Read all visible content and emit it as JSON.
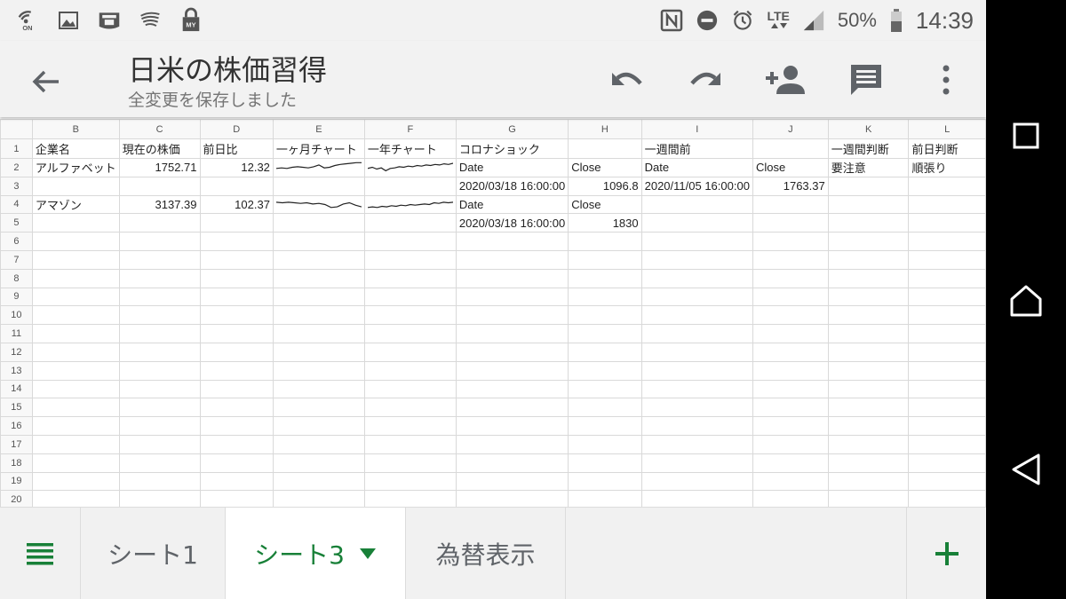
{
  "status_bar": {
    "battery": "50%",
    "time": "14:39",
    "network": "LTE",
    "left_icons": [
      "wifi-on-icon",
      "image-icon",
      "lawson-app-icon",
      "wing-app-icon",
      "lock-bag-icon"
    ],
    "right_icons": [
      "nfc-icon",
      "dnd-icon",
      "alarm-icon",
      "lte-icon",
      "signal-icon",
      "battery-icon"
    ]
  },
  "app_bar": {
    "title": "日米の株価習得",
    "subtitle": "全変更を保存しました",
    "actions": [
      "undo-icon",
      "redo-icon",
      "add-person-icon",
      "comment-icon",
      "more-vert-icon"
    ]
  },
  "sheet": {
    "columns": [
      "B",
      "C",
      "D",
      "E",
      "F",
      "G",
      "H",
      "I",
      "J",
      "K",
      "L"
    ],
    "rows": [
      [
        "企業名",
        "現在の株価",
        "前日比",
        "一ヶ月チャート",
        "一年チャート",
        "コロナショック",
        "",
        "一週間前",
        "",
        "一週間判断",
        "前日判断"
      ],
      [
        "アルファベット",
        "1752.71",
        "12.32",
        "",
        "",
        "Date",
        "Close",
        "Date",
        "Close",
        "要注意",
        "順張り"
      ],
      [
        "",
        "",
        "",
        "",
        "",
        "2020/03/18 16:00:00",
        "1096.8",
        "2020/11/05 16:00:00",
        "1763.37",
        "",
        ""
      ],
      [
        "アマゾン",
        "3137.39",
        "102.37",
        "",
        "",
        "Date",
        "Close",
        "",
        "",
        "",
        ""
      ],
      [
        "",
        "",
        "",
        "",
        "",
        "2020/03/18 16:00:00",
        "1830",
        "",
        "",
        "",
        ""
      ],
      [
        "",
        "",
        "",
        "",
        "",
        "",
        "",
        "",
        "",
        "",
        ""
      ],
      [
        "",
        "",
        "",
        "",
        "",
        "",
        "",
        "",
        "",
        "",
        ""
      ],
      [
        "",
        "",
        "",
        "",
        "",
        "",
        "",
        "",
        "",
        "",
        ""
      ],
      [
        "",
        "",
        "",
        "",
        "",
        "",
        "",
        "",
        "",
        "",
        ""
      ],
      [
        "",
        "",
        "",
        "",
        "",
        "",
        "",
        "",
        "",
        "",
        ""
      ],
      [
        "",
        "",
        "",
        "",
        "",
        "",
        "",
        "",
        "",
        "",
        ""
      ],
      [
        "",
        "",
        "",
        "",
        "",
        "",
        "",
        "",
        "",
        "",
        ""
      ],
      [
        "",
        "",
        "",
        "",
        "",
        "",
        "",
        "",
        "",
        "",
        ""
      ],
      [
        "",
        "",
        "",
        "",
        "",
        "",
        "",
        "",
        "",
        "",
        ""
      ],
      [
        "",
        "",
        "",
        "",
        "",
        "",
        "",
        "",
        "",
        "",
        ""
      ],
      [
        "",
        "",
        "",
        "",
        "",
        "",
        "",
        "",
        "",
        "",
        ""
      ],
      [
        "",
        "",
        "",
        "",
        "",
        "",
        "",
        "",
        "",
        "",
        ""
      ],
      [
        "",
        "",
        "",
        "",
        "",
        "",
        "",
        "",
        "",
        "",
        ""
      ],
      [
        "",
        "",
        "",
        "",
        "",
        "",
        "",
        "",
        "",
        "",
        ""
      ],
      [
        "",
        "",
        "",
        "",
        "",
        "",
        "",
        "",
        "",
        "",
        ""
      ]
    ],
    "sparklines": {
      "r2_month": [
        0.6,
        0.55,
        0.6,
        0.5,
        0.45,
        0.5,
        0.55,
        0.45,
        0.3,
        0.55,
        0.5,
        0.35,
        0.25,
        0.2,
        0.15,
        0.1,
        0.1
      ],
      "r2_year": [
        0.6,
        0.5,
        0.65,
        0.55,
        0.8,
        0.6,
        0.55,
        0.45,
        0.5,
        0.4,
        0.45,
        0.35,
        0.4,
        0.3,
        0.35,
        0.25,
        0.3,
        0.2,
        0.25,
        0.15
      ],
      "r4_month": [
        0.3,
        0.35,
        0.3,
        0.35,
        0.4,
        0.35,
        0.45,
        0.4,
        0.5,
        0.75,
        0.7,
        0.45,
        0.35,
        0.55,
        0.7
      ],
      "r4_year": [
        0.75,
        0.7,
        0.75,
        0.65,
        0.7,
        0.6,
        0.65,
        0.55,
        0.6,
        0.5,
        0.55,
        0.5,
        0.45,
        0.5,
        0.35,
        0.4,
        0.3,
        0.35,
        0.3
      ]
    }
  },
  "tabs": [
    {
      "label": "シート1",
      "active": false
    },
    {
      "label": "シート3",
      "active": true
    },
    {
      "label": "為替表示",
      "active": false
    }
  ],
  "colors": {
    "accent": "#188038",
    "icon": "#5f6368"
  },
  "nav_bar": [
    "recents-icon",
    "home-icon",
    "back-icon"
  ]
}
